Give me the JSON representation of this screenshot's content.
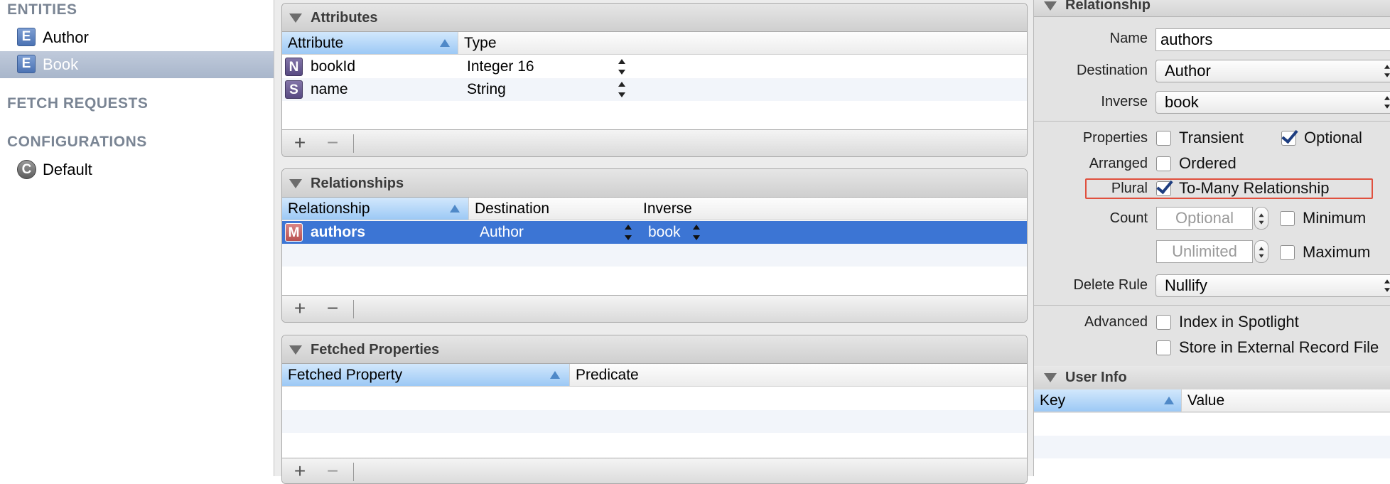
{
  "sidebar": {
    "entities_header": "ENTITIES",
    "entities": [
      {
        "badge": "E",
        "label": "Author",
        "selected": false
      },
      {
        "badge": "E",
        "label": "Book",
        "selected": true
      }
    ],
    "fetch_requests_header": "FETCH REQUESTS",
    "configurations_header": "CONFIGURATIONS",
    "configurations": [
      {
        "badge": "C",
        "label": "Default"
      }
    ]
  },
  "attributes": {
    "title": "Attributes",
    "columns": [
      "Attribute",
      "Type"
    ],
    "rows": [
      {
        "badge": "N",
        "name": "bookId",
        "type": "Integer 16"
      },
      {
        "badge": "S",
        "name": "name",
        "type": "String"
      }
    ],
    "add": "+",
    "remove": "−"
  },
  "relationships": {
    "title": "Relationships",
    "columns": [
      "Relationship",
      "Destination",
      "Inverse"
    ],
    "rows": [
      {
        "badge": "M",
        "name": "authors",
        "destination": "Author",
        "inverse": "book",
        "selected": true
      }
    ],
    "add": "+",
    "remove": "−"
  },
  "fetched_properties": {
    "title": "Fetched Properties",
    "columns": [
      "Fetched Property",
      "Predicate"
    ],
    "add": "+",
    "remove": "−"
  },
  "inspector": {
    "title": "Relationship",
    "name_label": "Name",
    "name_value": "authors",
    "destination_label": "Destination",
    "destination_value": "Author",
    "inverse_label": "Inverse",
    "inverse_value": "book",
    "properties_label": "Properties",
    "transient_label": "Transient",
    "transient_checked": false,
    "optional_label": "Optional",
    "optional_checked": true,
    "arranged_label": "Arranged",
    "ordered_label": "Ordered",
    "ordered_checked": false,
    "plural_label": "Plural",
    "to_many_label": "To-Many Relationship",
    "to_many_checked": true,
    "count_label": "Count",
    "count_min_placeholder": "Optional",
    "minimum_label": "Minimum",
    "count_max_placeholder": "Unlimited",
    "maximum_label": "Maximum",
    "delete_rule_label": "Delete Rule",
    "delete_rule_value": "Nullify",
    "advanced_label": "Advanced",
    "index_label": "Index in Spotlight",
    "store_label": "Store in External Record File"
  },
  "user_info": {
    "title": "User Info",
    "columns": [
      "Key",
      "Value"
    ]
  },
  "colors": {
    "selection": "#3c75d4",
    "sidebar_selection": "#aebbd0",
    "highlight_box": "#e0503e"
  }
}
